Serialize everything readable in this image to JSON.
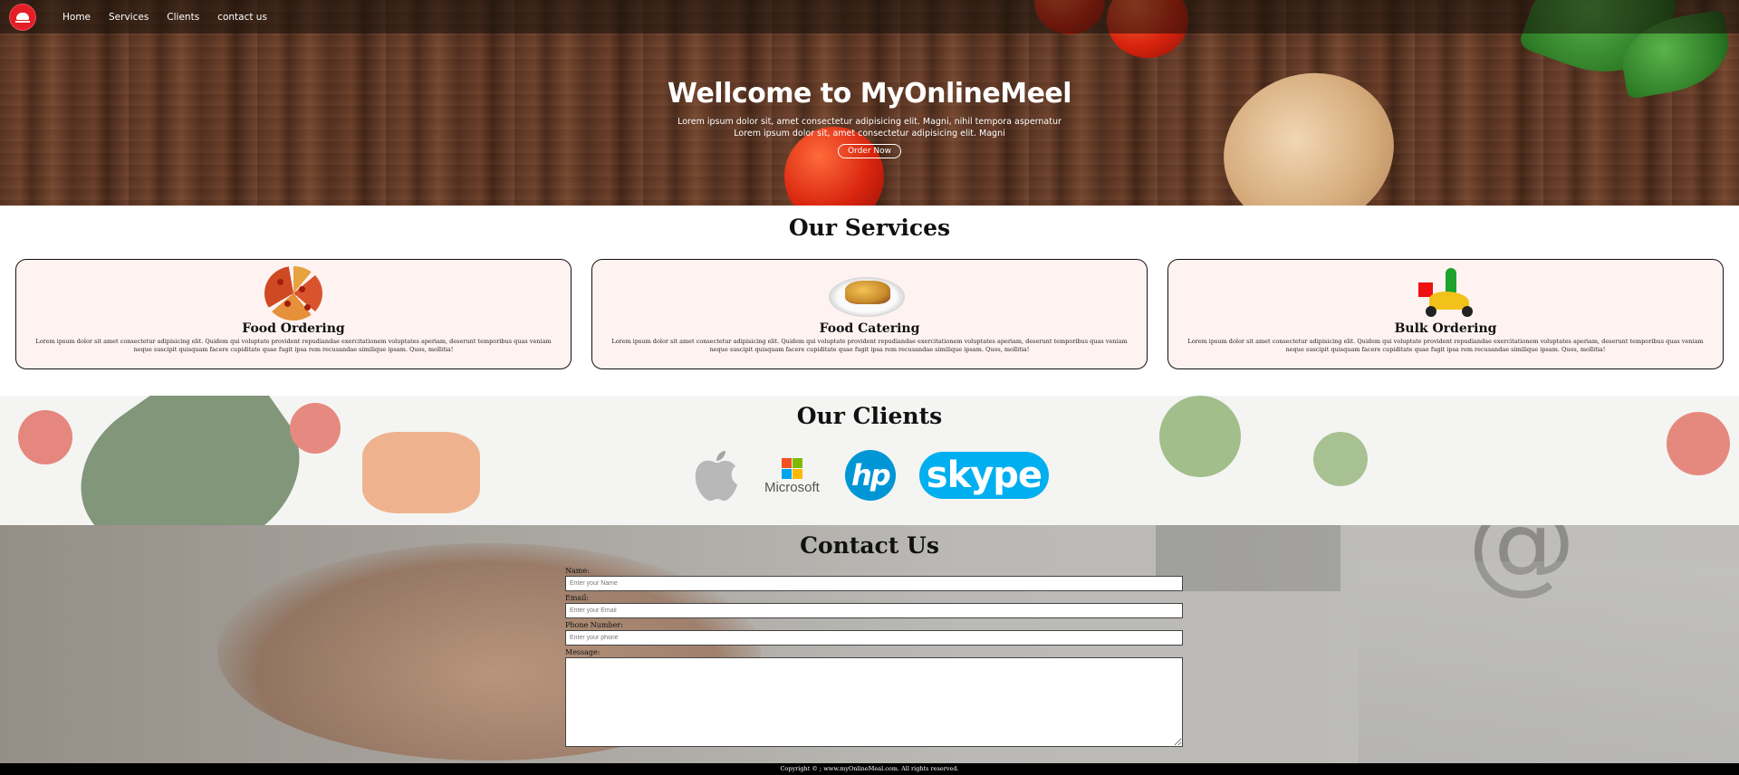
{
  "nav": {
    "links": [
      "Home",
      "Services",
      "Clients",
      "contact us"
    ]
  },
  "hero": {
    "title": "Wellcome to MyOnlineMeel",
    "subtitle_line1": "Lorem ipsum dolor sit, amet consectetur adipisicing elit. Magni, nihil tempora aspernatur",
    "subtitle_line2": "Lorem ipsum dolor sit, amet consectetur adipisicing elit. Magni",
    "button": "Order Now"
  },
  "services": {
    "title": "Our Services",
    "cards": [
      {
        "title": "Food Ordering",
        "text": "Lorem ipsum dolor sit amet consectetur adipisicing elit. Quidem qui voluptate provident repudiandae exercitationem voluptates aperiam, deserunt temporibus quas veniam neque suscipit quisquam facere cupiditate quae fugit ipsa rem recusandae similique ipsam. Quos, mollitia!"
      },
      {
        "title": "Food Catering",
        "text": "Lorem ipsum dolor sit amet consectetur adipisicing elit. Quidem qui voluptate provident repudiandae exercitationem voluptates aperiam, deserunt temporibus quas veniam neque suscipit quisquam facere cupiditate quae fugit ipsa rem recusandae similique ipsam. Quos, mollitia!"
      },
      {
        "title": "Bulk Ordering",
        "text": "Lorem ipsum dolor sit amet consectetur adipisicing elit. Quidem qui voluptate provident repudiandae exercitationem voluptates aperiam, deserunt temporibus quas veniam neque suscipit quisquam facere cupiditate quae fugit ipsa rem recusandae similique ipsam. Quos, mollitia!"
      }
    ]
  },
  "clients": {
    "title": "Our Clients",
    "logos": [
      "apple-logo",
      "Microsoft",
      "hp",
      "skype"
    ],
    "brand_colors": {
      "microsoft_red": "#f25022",
      "microsoft_green": "#7fba00",
      "microsoft_blue": "#00a4ef",
      "microsoft_yellow": "#ffb900",
      "hp_blue": "#0096d6",
      "skype_blue": "#00aff0"
    }
  },
  "contact": {
    "title": "Contact Us",
    "name_label": "Name:",
    "name_placeholder": "Enter your Name",
    "email_label": "Email:",
    "email_placeholder": "Enter your Email",
    "phone_label": "Phone Number:",
    "phone_placeholder": "Enter your phone",
    "message_label": "Message:"
  },
  "footer": {
    "text": "Copyright © ; www.myOnlineMeal.com. All rights reserved."
  },
  "colors": {
    "nav_bg": "#1a120c",
    "logo_red": "#e41e26",
    "card_bg": "#fff3f2",
    "footer_bg": "#000000"
  }
}
